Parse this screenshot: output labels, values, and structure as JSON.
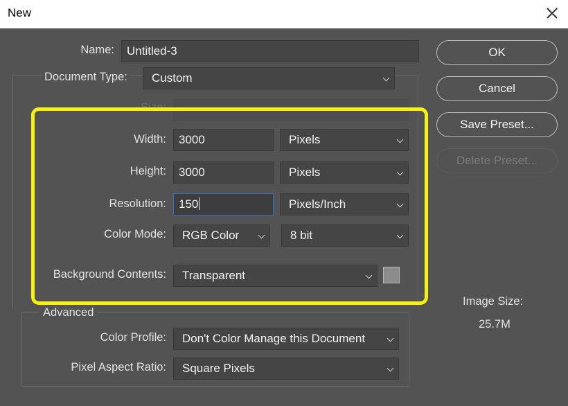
{
  "window": {
    "title": "New"
  },
  "form": {
    "name": {
      "label": "Name:",
      "value": "Untitled-3"
    },
    "document_type": {
      "label": "Document Type:",
      "value": "Custom"
    },
    "size": {
      "label": "Size:",
      "value": ""
    },
    "width": {
      "label": "Width:",
      "value": "3000",
      "unit": "Pixels"
    },
    "height": {
      "label": "Height:",
      "value": "3000",
      "unit": "Pixels"
    },
    "resolution": {
      "label": "Resolution:",
      "value": "150",
      "unit": "Pixels/Inch"
    },
    "color_mode": {
      "label": "Color Mode:",
      "value": "RGB Color",
      "depth": "8 bit"
    },
    "background_contents": {
      "label": "Background Contents:",
      "value": "Transparent",
      "swatch_color": "#8c8c8c"
    }
  },
  "advanced": {
    "title": "Advanced",
    "color_profile": {
      "label": "Color Profile:",
      "value": "Don't Color Manage this Document"
    },
    "pixel_aspect_ratio": {
      "label": "Pixel Aspect Ratio:",
      "value": "Square Pixels"
    }
  },
  "buttons": {
    "ok": "OK",
    "cancel": "Cancel",
    "save_preset": "Save Preset...",
    "delete_preset": "Delete Preset..."
  },
  "image_size": {
    "label": "Image Size:",
    "value": "25.7M"
  },
  "colors": {
    "dialog_bg": "#535353",
    "highlight": "#f5f20f",
    "focus": "#2d6cdc"
  }
}
